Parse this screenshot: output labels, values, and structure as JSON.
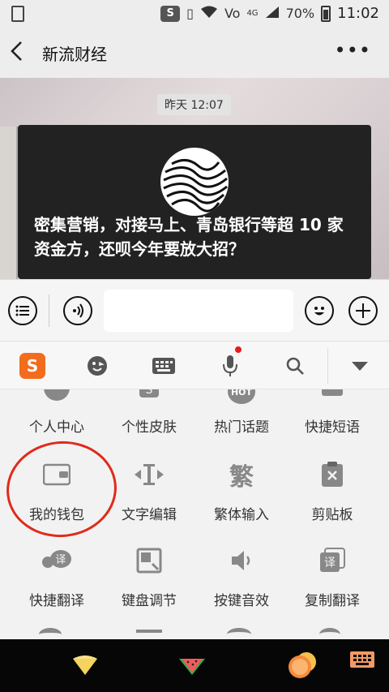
{
  "status_bar": {
    "network": "S",
    "network_type": "Vo",
    "network_gen": "4G",
    "battery": "70%",
    "time": "11:02"
  },
  "header": {
    "back_icon": "chevron-left-icon",
    "title": "新流财经",
    "more_icon": "more-dots-icon"
  },
  "chat": {
    "timestamp": "昨天 12:07",
    "card_title": "密集营销，对接马上、青岛银行等超 10 家资金方，还呗今年要放大招？"
  },
  "input_bar": {
    "left_icon": "list-icon",
    "voice_icon": "voice-icon",
    "placeholder": "",
    "emoji_icon": "emoji-icon",
    "plus_icon": "plus-icon"
  },
  "ime_toolbar": {
    "logo": "S",
    "items": [
      "sogou-logo-icon",
      "emoticon-icon",
      "keyboard-icon",
      "mic-icon",
      "search-icon",
      "collapse-icon"
    ]
  },
  "ime_grid": {
    "rows": [
      [
        {
          "label": "个人中心",
          "icon": "user-icon"
        },
        {
          "label": "个性皮肤",
          "icon": "skin-icon"
        },
        {
          "label": "热门话题",
          "icon": "hot-icon",
          "glyph": "HOT"
        },
        {
          "label": "快捷短语",
          "icon": "phrase-icon"
        }
      ],
      [
        {
          "label": "我的钱包",
          "icon": "wallet-icon"
        },
        {
          "label": "文字编辑",
          "icon": "text-cursor-icon"
        },
        {
          "label": "繁体输入",
          "icon": "traditional-chinese-icon",
          "glyph": "繁"
        },
        {
          "label": "剪贴板",
          "icon": "clipboard-icon"
        }
      ],
      [
        {
          "label": "快捷翻译",
          "icon": "translate-bubble-icon",
          "glyph": "译"
        },
        {
          "label": "键盘调节",
          "icon": "resize-icon"
        },
        {
          "label": "按键音效",
          "icon": "speaker-icon"
        },
        {
          "label": "复制翻译",
          "icon": "copy-translate-icon",
          "glyph": "译"
        }
      ]
    ]
  },
  "bottom_bar": {
    "items": [
      "cake-slice-icon",
      "watermelon-icon",
      "orange-icon",
      "keyboard-switch-icon"
    ]
  },
  "colors": {
    "sogou_orange": "#f36b1c",
    "annotation_red": "#e02a1a",
    "card_bg": "#222222"
  }
}
